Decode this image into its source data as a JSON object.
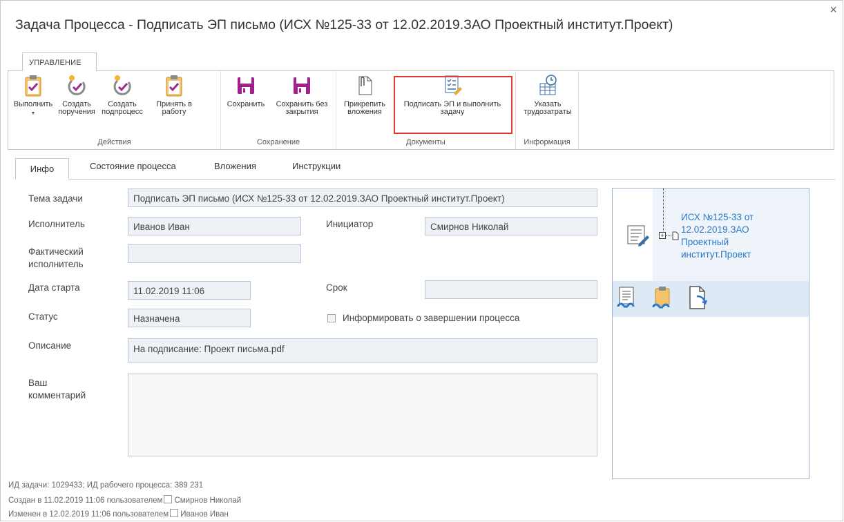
{
  "window": {
    "title": "Задача Процесса - Подписать ЭП письмо (ИСХ №125-33 от 12.02.2019.ЗАО Проектный институт.Проект)",
    "close": "×"
  },
  "ribbon": {
    "tab": "УПРАВЛЕНИЕ",
    "groups": {
      "actions": "Действия",
      "saving": "Сохранение",
      "documents": "Документы",
      "info": "Информация"
    },
    "buttons": {
      "execute": "Выполнить",
      "create_orders": "Создать\nпоручения",
      "create_subprocess": "Создать\nподпроцесс",
      "accept": "Принять в\nработу",
      "save": "Сохранить",
      "save_no_close": "Сохранить без\nзакрытия",
      "attach": "Прикрепить\nвложения",
      "sign_execute": "Подписать ЭП и выполнить\nзадачу",
      "labor": "Указать\nтрудозатраты"
    }
  },
  "tabs": [
    "Инфо",
    "Состояние процесса",
    "Вложения",
    "Инструкции"
  ],
  "form": {
    "subject_label": "Тема задачи",
    "subject_value": "Подписать ЭП письмо (ИСХ №125-33 от 12.02.2019.ЗАО Проектный институт.Проект)",
    "executor_label": "Исполнитель",
    "executor_value": "Иванов Иван",
    "initiator_label": "Инициатор",
    "initiator_value": "Смирнов Николай",
    "actual_label_1": "Фактический",
    "actual_label_2": "исполнитель",
    "actual_value": "",
    "start_label": "Дата старта",
    "start_value": "11.02.2019 11:06",
    "deadline_label": "Срок",
    "deadline_value": "",
    "status_label": "Статус",
    "status_value": "Назначена",
    "notify_label": "Информировать о завершении процесса",
    "desc_label": "Описание",
    "desc_value": "На подписание: Проект письма.pdf",
    "comment_label_1": "Ваш",
    "comment_label_2": "комментарий",
    "comment_value": ""
  },
  "panel": {
    "link_lines": [
      "ИСХ №125-33 от",
      "12.02.2019.ЗАО",
      "Проектный",
      "институт.Проект"
    ]
  },
  "footer": {
    "ids": "ИД задачи: 1029433; ИД рабочего процесса: 389 231",
    "created_prefix": "Создан в 11.02.2019 11:06 пользователем",
    "created_user": "Смирнов Николай",
    "changed_prefix": "Изменен в 12.02.2019 11:06 пользователем",
    "changed_user": "Иванов Иван"
  },
  "colors": {
    "accent": "#2b79c8",
    "highlight": "#e03b3b",
    "save_icon": "#a3218f",
    "task_icon": "#e8a838"
  }
}
